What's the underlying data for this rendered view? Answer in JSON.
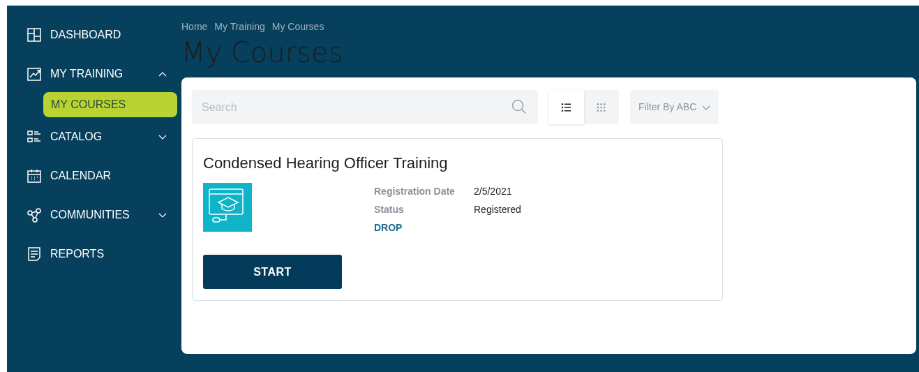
{
  "sidebar": {
    "items": [
      {
        "label": "DASHBOARD"
      },
      {
        "label": "MY TRAINING",
        "expanded": true,
        "children": [
          {
            "label": "MY COURSES",
            "selected": true
          }
        ]
      },
      {
        "label": "CATALOG",
        "expanded": false
      },
      {
        "label": "CALENDAR"
      },
      {
        "label": "COMMUNITIES",
        "expanded": false
      },
      {
        "label": "REPORTS"
      }
    ]
  },
  "breadcrumb": [
    "Home",
    "My Training",
    "My Courses"
  ],
  "page_title": "My Courses",
  "toolbar": {
    "search": {
      "placeholder": "Search"
    },
    "views": [
      {
        "kind": "list",
        "selected": true
      },
      {
        "kind": "grid",
        "selected": false
      }
    ],
    "filter": "Filter By ABC"
  },
  "courses": [
    {
      "title": "Condensed Hearing Officer Training",
      "fields": [
        {
          "label": "Registration Date",
          "value": "2/5/2021"
        },
        {
          "label": "Status",
          "value": "Registered"
        }
      ],
      "link": "DROP",
      "button": "START"
    }
  ]
}
